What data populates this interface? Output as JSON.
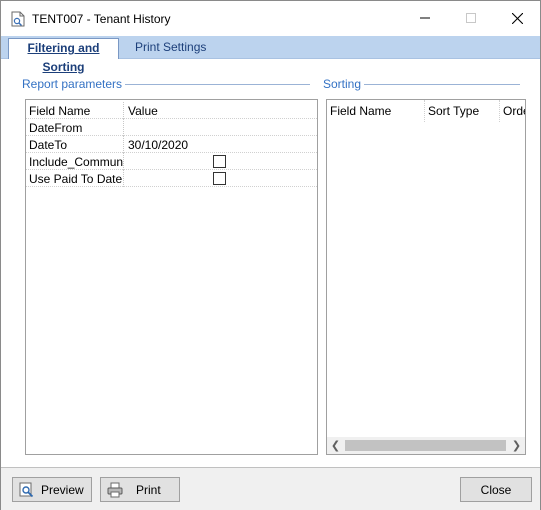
{
  "window": {
    "title": "TENT007 - Tenant History"
  },
  "tabs": [
    {
      "label": "Filtering and Sorting",
      "active": true
    },
    {
      "label": "Print Settings",
      "active": false
    }
  ],
  "report_parameters": {
    "group_label": "Report parameters",
    "columns": {
      "field_name": "Field Name",
      "value": "Value"
    },
    "rows": [
      {
        "field": "DateFrom",
        "value": ""
      },
      {
        "field": "DateTo",
        "value": "30/10/2020"
      },
      {
        "field": "Include_Commun...",
        "value": "",
        "checkbox": true,
        "checked": false
      },
      {
        "field": "Use Paid To Date",
        "value": "",
        "checkbox": true,
        "checked": false
      }
    ]
  },
  "sorting": {
    "group_label": "Sorting",
    "columns": [
      "Field Name",
      "Sort Type",
      "Orde"
    ]
  },
  "footer": {
    "preview_label": "Preview",
    "print_label": "Print",
    "close_label": "Close"
  }
}
